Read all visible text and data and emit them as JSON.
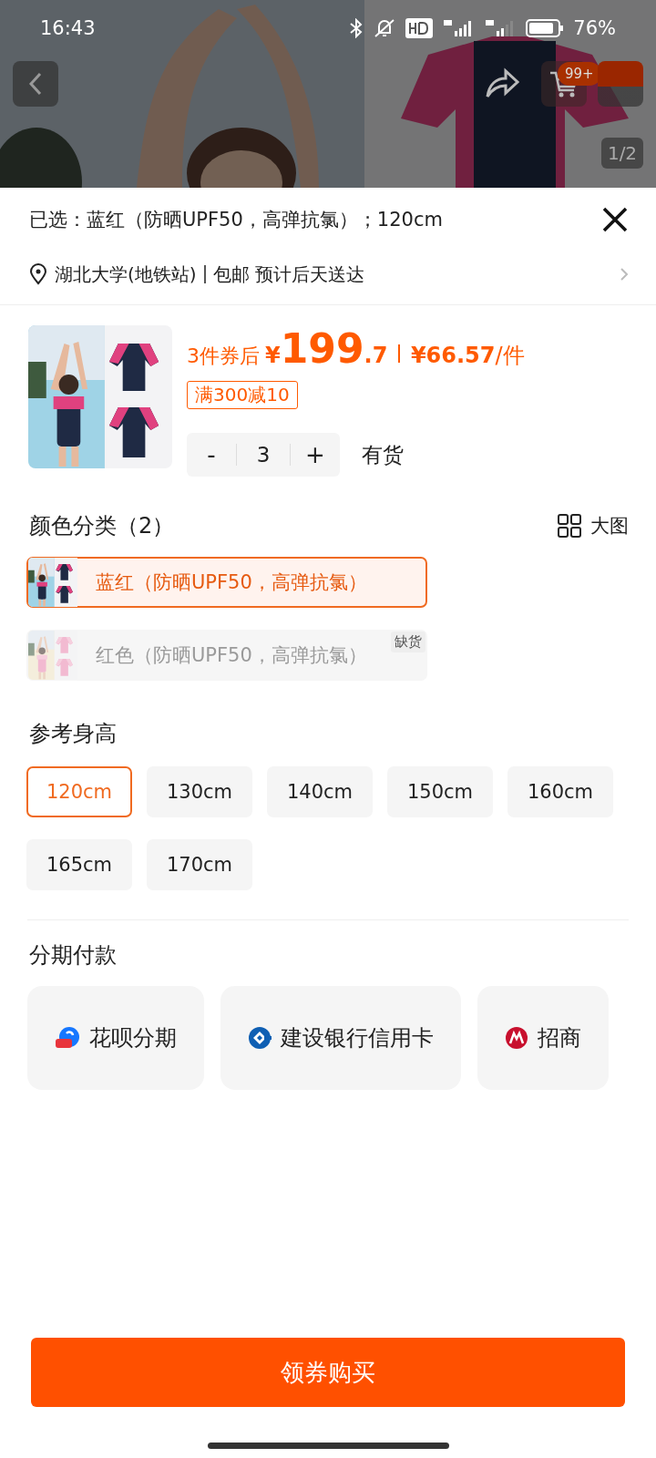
{
  "status_bar": {
    "time": "16:43",
    "battery": "76%"
  },
  "gallery": {
    "cart_badge": "99+",
    "page_indicator": "1/2"
  },
  "sheet": {
    "selected_summary": "已选：蓝红（防晒UPF50，高弹抗氯）；120cm",
    "address": {
      "location": "湖北大学(地铁站)",
      "shipping": "包邮 预计后天送达"
    },
    "product": {
      "price_prefix": "3件券后",
      "price": {
        "currency": "¥",
        "integer": "199",
        "decimal": ".7"
      },
      "unit_price": {
        "amount": "¥66.57",
        "unit": "/件"
      },
      "coupon": "满300减10",
      "quantity": {
        "minus": "-",
        "value": "3",
        "plus": "+"
      },
      "stock": "有货"
    },
    "color_section": {
      "title": "颜色分类（2）",
      "view_toggle": "大图",
      "options": [
        {
          "label": "蓝红（防晒UPF50，高弹抗氯）",
          "selected": true,
          "disabled": false
        },
        {
          "label": "红色（防晒UPF50，高弹抗氯）",
          "selected": false,
          "disabled": true,
          "badge": "缺货"
        }
      ]
    },
    "size_section": {
      "title": "参考身高",
      "options": [
        {
          "label": "120cm",
          "selected": true
        },
        {
          "label": "130cm",
          "selected": false
        },
        {
          "label": "140cm",
          "selected": false
        },
        {
          "label": "150cm",
          "selected": false
        },
        {
          "label": "160cm",
          "selected": false
        },
        {
          "label": "165cm",
          "selected": false
        },
        {
          "label": "170cm",
          "selected": false
        }
      ]
    },
    "installment": {
      "title": "分期付款",
      "options": [
        {
          "label": "花呗分期",
          "kind": "huabei"
        },
        {
          "label": "建设银行信用卡",
          "kind": "ccb"
        },
        {
          "label": "招商",
          "kind": "cmb"
        }
      ]
    },
    "buy_button": "领券购买"
  }
}
